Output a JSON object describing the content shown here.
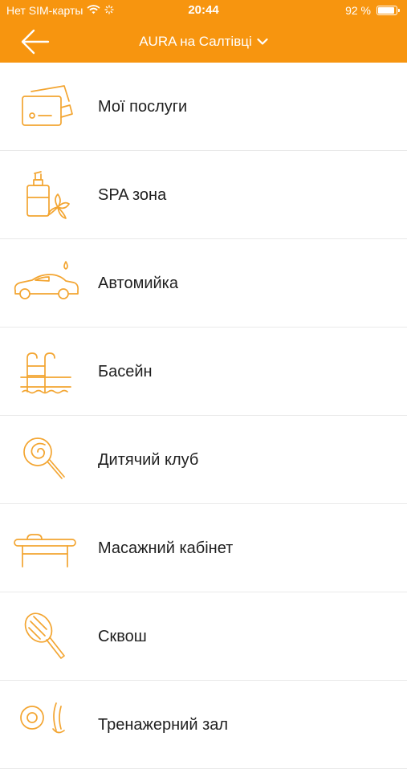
{
  "status_bar": {
    "carrier": "Нет SIM-карты",
    "time": "20:44",
    "battery_percent": "92 %",
    "battery_level": 0.92
  },
  "header": {
    "title": "AURA на Салтівці",
    "back_icon": "arrow-left-icon",
    "dropdown_icon": "chevron-down-icon"
  },
  "colors": {
    "brand": "#f7950f",
    "icon": "#f3a531",
    "divider": "#e9e9e9",
    "text": "#1f1f1f"
  },
  "menu": {
    "items": [
      {
        "label": "Мої послуги",
        "icon": "card-icon"
      },
      {
        "label": "SPA зона",
        "icon": "spa-bottle-icon"
      },
      {
        "label": "Автомийка",
        "icon": "car-wash-icon"
      },
      {
        "label": "Басейн",
        "icon": "pool-ladder-icon"
      },
      {
        "label": "Дитячий клуб",
        "icon": "lollipop-icon"
      },
      {
        "label": "Масажний кабінет",
        "icon": "massage-table-icon"
      },
      {
        "label": "Сквош",
        "icon": "squash-racket-icon"
      },
      {
        "label": "Тренажерний зал",
        "icon": "gym-icon"
      }
    ]
  }
}
